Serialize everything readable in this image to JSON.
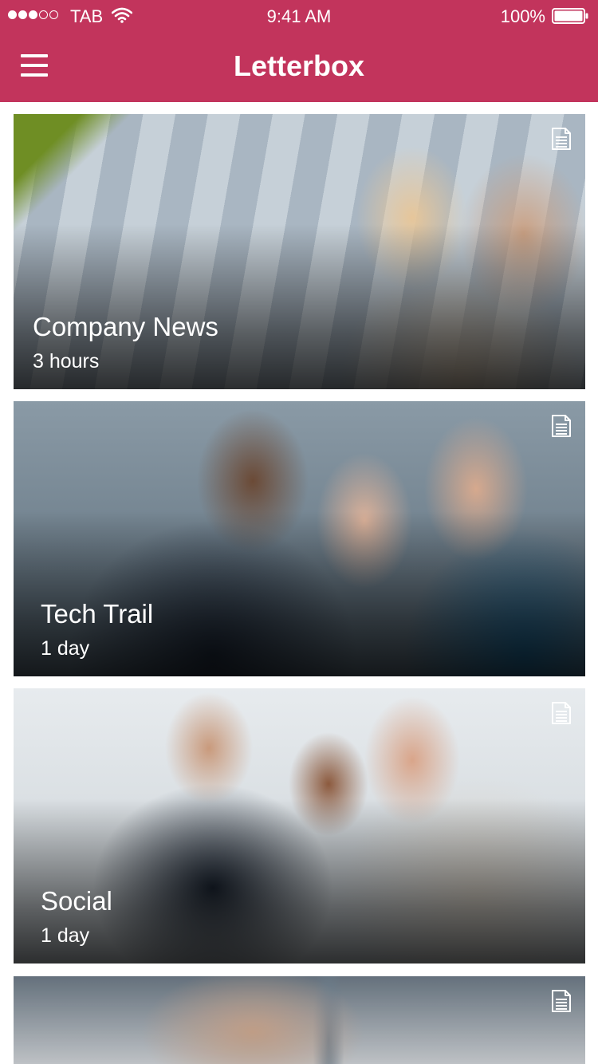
{
  "status_bar": {
    "carrier": "TAB",
    "time": "9:41 AM",
    "battery_percent": "100%",
    "signal_bars_filled": 3,
    "signal_bars_total": 5,
    "battery_level": 1.0
  },
  "header": {
    "title": "Letterbox",
    "menu_icon": "hamburger-menu-icon",
    "background_color": "#c2345c"
  },
  "cards": [
    {
      "title": "Company News",
      "time": "3 hours",
      "icon": "document-icon"
    },
    {
      "title": "Tech Trail",
      "time": "1 day",
      "icon": "document-icon"
    },
    {
      "title": "Social",
      "time": "1 day",
      "icon": "document-icon"
    },
    {
      "title": "",
      "time": "",
      "icon": "document-icon"
    }
  ]
}
